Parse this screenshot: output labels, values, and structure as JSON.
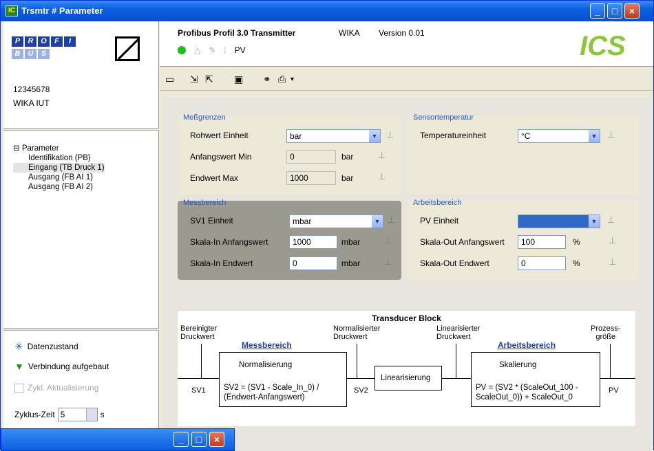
{
  "window": {
    "title": "Trsmtr # Parameter",
    "icon": "ics-app-icon"
  },
  "colors": {
    "titlebar": "#0a5fe0",
    "accent": "#2a55c8",
    "dark_group": "#9b9a91",
    "selected": "#316ac5"
  },
  "left": {
    "profibus_letters_top": [
      "P",
      "R",
      "O",
      "F",
      "I"
    ],
    "profibus_letters_bottom": [
      "B",
      "U",
      "S"
    ],
    "device_id": "12345678",
    "device_name": "WIKA IUT",
    "tree": {
      "root": "Parameter",
      "items": [
        "Identifikation (PB)",
        "Eingang (TB Druck 1)",
        "Ausgang (FB AI 1)",
        "Ausgang (FB AI 2)"
      ]
    },
    "status": {
      "data_state": "Datenzustand",
      "connection": "Verbindung aufgebaut",
      "cyclic_update": "Zykl. Aktualisierung"
    },
    "cycle": {
      "label": "Zyklus-Zeit",
      "value": "5",
      "unit": "s"
    }
  },
  "header": {
    "device": "Profibus Profil 3.0 Transmitter",
    "vendor": "WIKA",
    "version": "Version 0.01",
    "pv": "PV"
  },
  "groups": {
    "messgrenzen": {
      "title": "Meßgrenzen",
      "rohwert_label": "Rohwert Einheit",
      "rohwert_value": "bar",
      "min_label": "Anfangswert Min",
      "min_value": "0",
      "min_unit": "bar",
      "max_label": "Endwert Max",
      "max_value": "1000",
      "max_unit": "bar"
    },
    "sensortemp": {
      "title": "Sensortemperatur",
      "label": "Temperatureinheit",
      "value": "°C"
    },
    "messbereich": {
      "title": "Messbereich",
      "sv1_label": "SV1 Einheit",
      "sv1_value": "mbar",
      "start_label": "Skala-In Anfangswert",
      "start_value": "1000",
      "start_unit": "mbar",
      "end_label": "Skala-In Endwert",
      "end_value": "0",
      "end_unit": "mbar"
    },
    "arbeitsbereich": {
      "title": "Arbeitsbereich",
      "pv_label": "PV Einheit",
      "pv_value": "",
      "start_label": "Skala-Out Anfangswert",
      "start_value": "100",
      "start_unit": "%",
      "end_label": "Skala-Out Endwert",
      "end_value": "0",
      "end_unit": "%"
    }
  },
  "transducer": {
    "title": "Transducer Block",
    "lbl_bereinigter": "Bereinigter\nDruckwert",
    "lbl_normalisierter": "Normalisierter\nDruckwert",
    "lbl_linearisierter": "Linearisierter\nDruckwert",
    "lbl_prozess": "Prozess-\ngröße",
    "link_messbereich": "Messbereich",
    "link_arbeitsbereich": "Arbeitsbereich",
    "box_norm_title": "Normalisierung",
    "box_norm_formula": "SV2 = (SV1 - Scale_In_0) /\n(Endwert-Anfangswert)",
    "box_lin": "Linearisierung",
    "box_skal_title": "Skalierung",
    "box_skal_formula": "PV = (SV2 * (ScaleOut_100 -\nScaleOut_0)) + ScaleOut_0",
    "sv1": "SV1",
    "sv2": "SV2",
    "pv": "PV"
  }
}
